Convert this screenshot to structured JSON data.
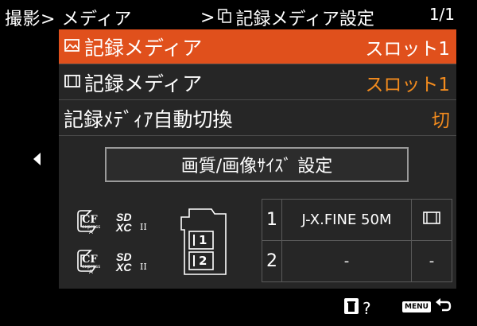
{
  "header": {
    "breadcrumb": "撮影",
    "section": "メディア",
    "submenu_title": "記録メディア設定",
    "page": "1/1"
  },
  "rows": [
    {
      "label": "記録メディア",
      "icon": "still-image-icon",
      "value": "スロット1"
    },
    {
      "label": "記録メディア",
      "icon": "movie-icon",
      "value": "スロット1"
    },
    {
      "label": "記録ﾒﾃﾞｨｱ自動切換",
      "value": "切"
    }
  ],
  "quality_button": {
    "label": "画質/画像ｻｲｽﾞ 設定"
  },
  "media_logos": {
    "cf_top": "CF",
    "cf_sub": "express",
    "cf_type": "A",
    "sd_top": "SD",
    "sd_sub": "XC",
    "sd_class": "II"
  },
  "camera_slots": [
    "1",
    "2"
  ],
  "slot_table": [
    {
      "slot": "1",
      "setting": "J-X.FINE 50M",
      "icon": "movie-film-icon"
    },
    {
      "slot": "2",
      "setting": "-",
      "icon": "-"
    }
  ],
  "footer": {
    "help_label": "?",
    "menu_label": "MENU"
  },
  "colors": {
    "accent": "#e0501c",
    "value_orange": "#f28b1e",
    "panel": "#262626"
  }
}
